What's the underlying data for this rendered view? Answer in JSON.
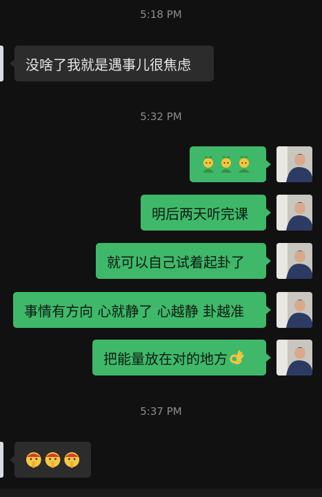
{
  "timestamps": [
    "5:18 PM",
    "5:32 PM",
    "5:37 PM"
  ],
  "messages": [
    {
      "side": "in",
      "text": "没啥了我就是遇事儿很焦虑"
    },
    {
      "side": "out",
      "text": "",
      "emoji": "sprout-person-emoji x3"
    },
    {
      "side": "out",
      "text": "明后两天听完课"
    },
    {
      "side": "out",
      "text": "就可以自己试着起卦了"
    },
    {
      "side": "out",
      "text": "事情有方向 心就静了 心越静 卦越准"
    },
    {
      "side": "out",
      "text": "把能量放在对的地方",
      "emoji": "ok-hand-emoji"
    },
    {
      "side": "in",
      "text": "",
      "emoji": "shushing-face-emoji x3"
    }
  ],
  "colors": {
    "background": "#111111",
    "incoming_bubble": "#2c2c2c",
    "outgoing_bubble": "#3fb86a",
    "timestamp": "#8d8d8d"
  }
}
